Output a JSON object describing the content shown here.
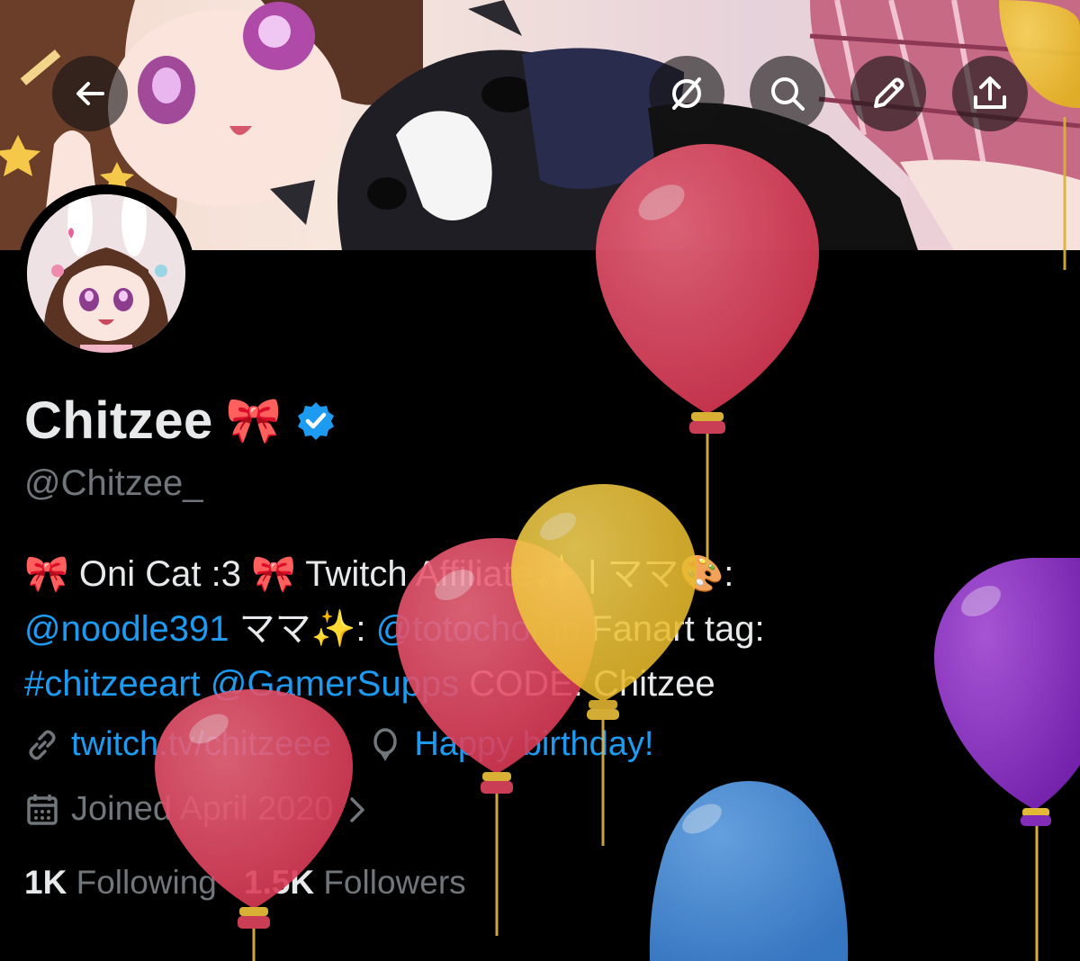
{
  "profile": {
    "name": "Chitzee",
    "name_emoji": "🎀",
    "handle": "@Chitzee_",
    "verified": true
  },
  "header": {
    "buttons": [
      {
        "name": "back-button",
        "icon": "arrow-left-icon"
      },
      {
        "name": "grok-button",
        "icon": "slash-circle-icon"
      },
      {
        "name": "search-button",
        "icon": "search-icon"
      },
      {
        "name": "edit-button",
        "icon": "pencil-icon"
      },
      {
        "name": "share-button",
        "icon": "share-upload-icon"
      }
    ]
  },
  "bio": {
    "line1": {
      "a": "🎀 Oni Cat :3 🎀 Twitch Affiliate✨ | ママ🎨: "
    },
    "line2": {
      "mention1": "@noodle391",
      "text1": " ママ✨: ",
      "mention2": "@totochomp",
      "text2": " Fanart tag: "
    },
    "line3": {
      "hashtag": "#chitzeeart",
      "text1": " ",
      "mention": "@GamerSupps",
      "text2": " CODE: Chitzee"
    }
  },
  "meta": {
    "website": "twitch.tv/chitzeee",
    "birthday": "Happy birthday!",
    "joined": "Joined April 2020"
  },
  "stats": {
    "following_count": "1K",
    "following_label": "Following",
    "followers_count": "1.5K",
    "followers_label": "Followers"
  },
  "colors": {
    "link": "#1d9bf0",
    "muted": "#71767b",
    "text": "#e7e9ea",
    "verified": "#1d9bf0",
    "balloon_red": "#e0455f",
    "balloon_yellow": "#f0c43c",
    "balloon_purple": "#9234c9",
    "balloon_blue": "#4a90d9"
  }
}
